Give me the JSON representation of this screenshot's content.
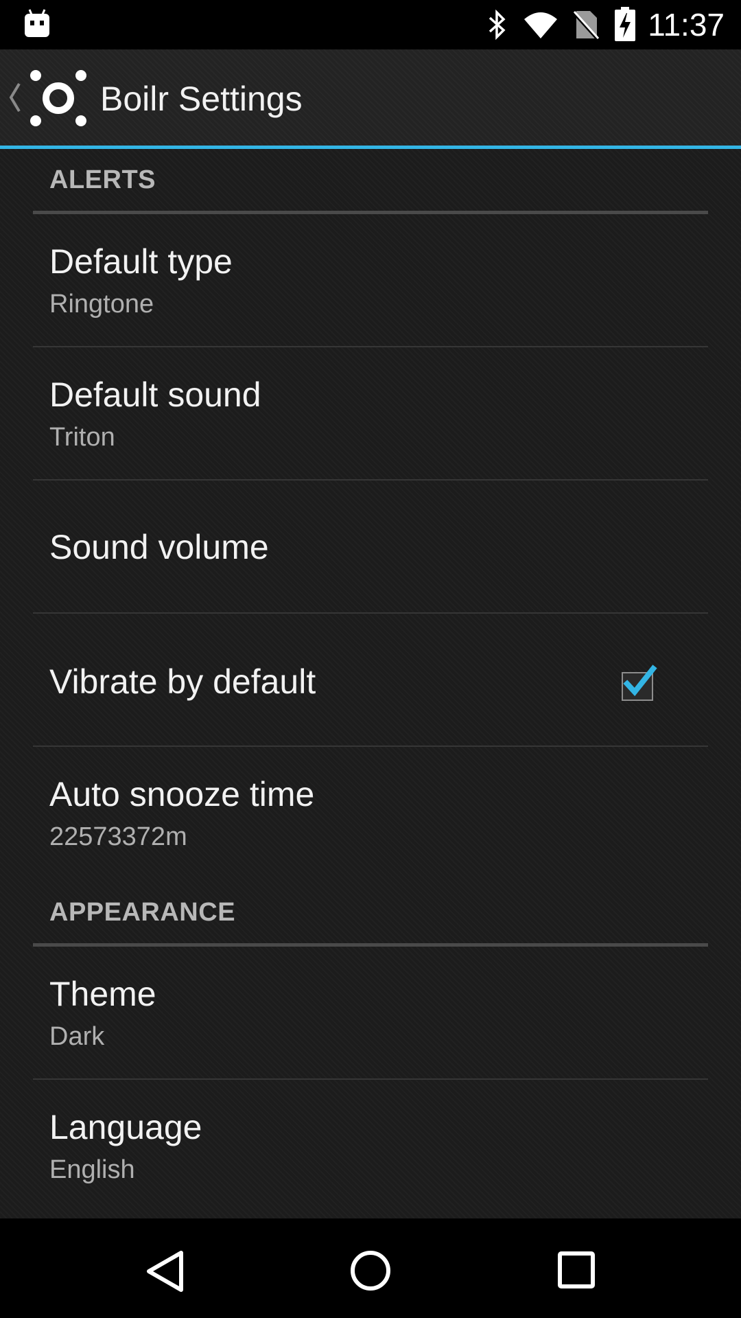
{
  "status_bar": {
    "time": "11:37",
    "icons": [
      "android-notification-icon",
      "bluetooth-icon",
      "wifi-icon",
      "no-sim-icon",
      "battery-charging-icon"
    ]
  },
  "action_bar": {
    "title": "Boilr Settings",
    "icons": [
      "back-chevron-icon",
      "boilr-logo-icon"
    ],
    "accent_color": "#33b5e5"
  },
  "categories": {
    "alerts": "ALERTS",
    "appearance": "APPEARANCE"
  },
  "preferences": {
    "default_type": {
      "title": "Default type",
      "summary": "Ringtone"
    },
    "default_sound": {
      "title": "Default sound",
      "summary": "Triton"
    },
    "sound_volume": {
      "title": "Sound volume"
    },
    "vibrate_by_default": {
      "title": "Vibrate by default",
      "checked": true
    },
    "auto_snooze_time": {
      "title": "Auto snooze time",
      "summary": "22573372m"
    },
    "theme": {
      "title": "Theme",
      "summary": "Dark"
    },
    "language": {
      "title": "Language",
      "summary": "English"
    }
  },
  "nav_bar": {
    "icons": [
      "back-triangle-icon",
      "home-circle-icon",
      "recents-square-icon"
    ]
  }
}
